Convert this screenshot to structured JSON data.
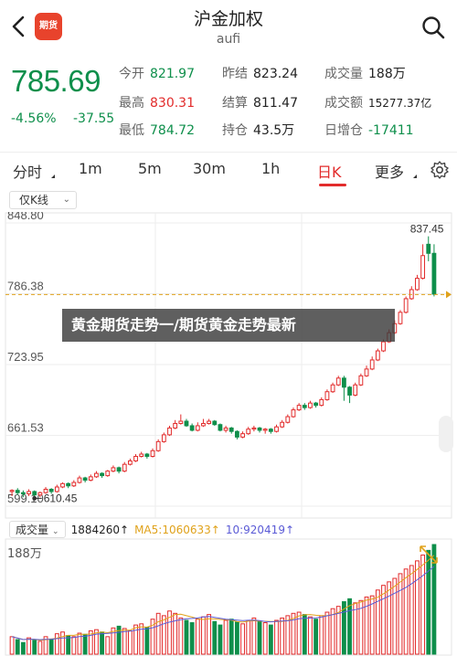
{
  "header": {
    "title": "沪金加权",
    "subtitle": "aufi",
    "app_logo_text": "期货",
    "back_icon": "chevron-left-icon",
    "search_icon": "search-icon"
  },
  "quote": {
    "price": "785.69",
    "change_pct": "-4.56%",
    "change": "-37.55",
    "stats": [
      {
        "label": "今开",
        "value": "821.97",
        "color": "green"
      },
      {
        "label": "昨结",
        "value": "823.24",
        "color": "plain"
      },
      {
        "label": "成交量",
        "value": "188万",
        "color": "plain"
      },
      {
        "label": "最高",
        "value": "830.31",
        "color": "red"
      },
      {
        "label": "结算",
        "value": "811.47",
        "color": "plain"
      },
      {
        "label": "成交额",
        "value": "15277.37亿",
        "color": "plain"
      },
      {
        "label": "最低",
        "value": "784.72",
        "color": "green"
      },
      {
        "label": "持仓",
        "value": "43.5万",
        "color": "plain"
      },
      {
        "label": "日增仓",
        "value": "-17411",
        "color": "green"
      }
    ]
  },
  "tabs": [
    "分时",
    "1m",
    "5m",
    "30m",
    "1h",
    "日K",
    "更多"
  ],
  "active_tab": "日K",
  "settings_icon": "gear-icon",
  "filter": {
    "label": "仅K线"
  },
  "chart_data": {
    "type": "candlestick",
    "y_ticks": [
      "848.80",
      "786.38",
      "723.95",
      "661.53",
      "599.10"
    ],
    "ylim": [
      599.1,
      848.8
    ],
    "high_label": "837.45",
    "low_label": "610.45",
    "last_price": 785.69,
    "colors": {
      "up": "#e22b2b",
      "down": "#0e8f4b",
      "last_line": "#e0a21b"
    },
    "candles": [
      [
        612,
        613,
        608,
        614
      ],
      [
        613,
        611,
        609,
        615
      ],
      [
        611,
        610,
        607,
        613
      ],
      [
        610,
        612,
        608,
        614
      ],
      [
        612,
        609,
        606,
        613
      ],
      [
        609,
        611,
        607,
        612
      ],
      [
        611,
        614,
        610,
        616
      ],
      [
        614,
        612,
        610,
        615
      ],
      [
        612,
        616,
        611,
        618
      ],
      [
        616,
        619,
        615,
        620
      ],
      [
        619,
        617,
        615,
        620
      ],
      [
        617,
        620,
        616,
        622
      ],
      [
        620,
        624,
        619,
        626
      ],
      [
        624,
        622,
        620,
        625
      ],
      [
        622,
        625,
        621,
        627
      ],
      [
        625,
        628,
        624,
        630
      ],
      [
        628,
        626,
        624,
        629
      ],
      [
        626,
        630,
        625,
        631
      ],
      [
        630,
        633,
        629,
        635
      ],
      [
        633,
        630,
        628,
        634
      ],
      [
        630,
        636,
        629,
        638
      ],
      [
        636,
        639,
        635,
        641
      ],
      [
        639,
        643,
        638,
        645
      ],
      [
        643,
        645,
        642,
        647
      ],
      [
        645,
        643,
        641,
        646
      ],
      [
        643,
        648,
        642,
        650
      ],
      [
        648,
        656,
        647,
        658
      ],
      [
        656,
        662,
        655,
        664
      ],
      [
        662,
        668,
        661,
        670
      ],
      [
        668,
        672,
        667,
        675
      ],
      [
        672,
        674,
        671,
        680
      ],
      [
        674,
        670,
        669,
        676
      ],
      [
        670,
        666,
        665,
        672
      ],
      [
        666,
        670,
        665,
        673
      ],
      [
        670,
        672,
        669,
        676
      ],
      [
        672,
        674,
        671,
        676
      ],
      [
        674,
        671,
        670,
        675
      ],
      [
        671,
        666,
        665,
        672
      ],
      [
        666,
        668,
        664,
        670
      ],
      [
        668,
        665,
        663,
        669
      ],
      [
        665,
        660,
        658,
        666
      ],
      [
        660,
        663,
        659,
        665
      ],
      [
        663,
        667,
        662,
        669
      ],
      [
        667,
        668,
        665,
        670
      ],
      [
        668,
        666,
        664,
        669
      ],
      [
        666,
        667,
        663,
        668
      ],
      [
        667,
        665,
        663,
        668
      ],
      [
        665,
        669,
        664,
        671
      ],
      [
        669,
        673,
        668,
        675
      ],
      [
        673,
        678,
        672,
        680
      ],
      [
        678,
        684,
        677,
        686
      ],
      [
        684,
        688,
        683,
        690
      ],
      [
        688,
        686,
        684,
        690
      ],
      [
        686,
        690,
        685,
        692
      ],
      [
        690,
        688,
        686,
        691
      ],
      [
        688,
        693,
        687,
        695
      ],
      [
        693,
        700,
        692,
        702
      ],
      [
        700,
        706,
        699,
        708
      ],
      [
        706,
        712,
        705,
        714
      ],
      [
        712,
        704,
        692,
        714
      ],
      [
        704,
        697,
        690,
        705
      ],
      [
        697,
        706,
        696,
        708
      ],
      [
        706,
        714,
        705,
        716
      ],
      [
        714,
        720,
        713,
        723
      ],
      [
        720,
        728,
        719,
        731
      ],
      [
        728,
        736,
        727,
        738
      ],
      [
        736,
        744,
        735,
        746
      ],
      [
        744,
        752,
        743,
        755
      ],
      [
        752,
        760,
        751,
        763
      ],
      [
        760,
        770,
        759,
        772
      ],
      [
        770,
        782,
        769,
        784
      ],
      [
        782,
        790,
        781,
        793
      ],
      [
        790,
        800,
        789,
        803
      ],
      [
        800,
        820,
        799,
        830
      ],
      [
        830,
        822,
        815,
        837
      ],
      [
        822,
        786,
        784,
        830
      ]
    ],
    "volume_label": "成交量",
    "volume_total": "1884260",
    "ma5_label": "MA5:1060633",
    "ma10_label": "10:920419",
    "volume_ymax_label": "188万",
    "volumes": [
      30,
      25,
      20,
      28,
      24,
      22,
      30,
      26,
      35,
      38,
      32,
      30,
      36,
      34,
      40,
      42,
      38,
      30,
      45,
      48,
      44,
      40,
      50,
      52,
      46,
      60,
      70,
      66,
      74,
      70,
      62,
      58,
      54,
      60,
      64,
      68,
      56,
      50,
      58,
      60,
      55,
      52,
      58,
      62,
      56,
      54,
      50,
      58,
      62,
      66,
      70,
      72,
      68,
      64,
      60,
      66,
      72,
      78,
      82,
      90,
      95,
      88,
      92,
      98,
      100,
      110,
      118,
      124,
      130,
      138,
      146,
      152,
      160,
      170,
      178,
      188
    ]
  },
  "banner": {
    "text": "黄金期货走势一/期货黄金走势最新"
  }
}
